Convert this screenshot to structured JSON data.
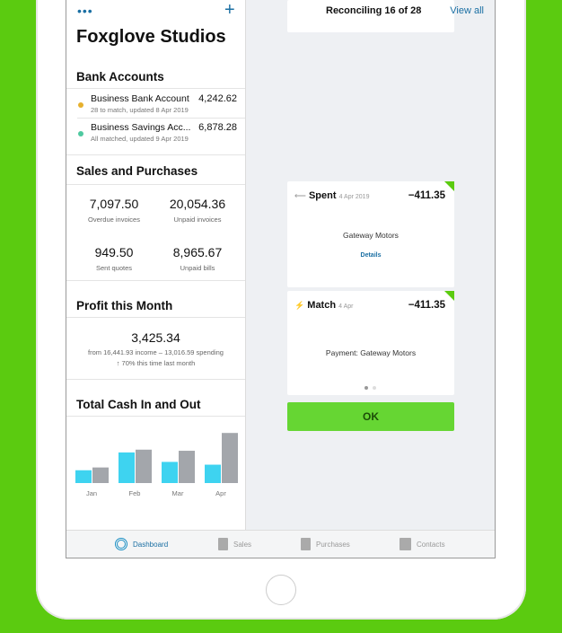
{
  "header": {
    "more": "•••",
    "add": "+",
    "org": "Foxglove Studios"
  },
  "bank": {
    "title": "Bank Accounts",
    "accounts": [
      {
        "name": "Business Bank Account",
        "amount": "4,242.62",
        "sub": "28 to match, updated 8 Apr 2019",
        "color": "#e6b02e"
      },
      {
        "name": "Business Savings Acc...",
        "amount": "6,878.28",
        "sub": "All matched, updated 9 Apr 2019",
        "color": "#4fc9a0"
      }
    ]
  },
  "sales": {
    "title": "Sales and Purchases",
    "stats": [
      {
        "value": "7,097.50",
        "label": "Overdue invoices"
      },
      {
        "value": "20,054.36",
        "label": "Unpaid invoices"
      },
      {
        "value": "949.50",
        "label": "Sent quotes"
      },
      {
        "value": "8,965.67",
        "label": "Unpaid bills"
      }
    ]
  },
  "profit": {
    "title": "Profit this Month",
    "value": "3,425.34",
    "detail": "from 16,441.93 income – 13,016.59 spending",
    "trend": "↑ 70% this time last month"
  },
  "chart_data": {
    "type": "bar",
    "title": "Total Cash In and Out",
    "categories": [
      "Jan",
      "Feb",
      "Mar",
      "Apr"
    ],
    "series": [
      {
        "values": [
          23,
          55,
          38,
          33
        ],
        "color": "#3ed3f0"
      },
      {
        "values": [
          28,
          60,
          58,
          90
        ],
        "color": "#a3a6ab"
      }
    ]
  },
  "reconcile": {
    "title": "Reconciling 16 of 28",
    "view_all": "View all",
    "spent": {
      "label": "Spent",
      "date": "4 Apr 2019",
      "amount": "−411.35",
      "payee": "Gateway Motors",
      "details": "Details"
    },
    "match": {
      "label": "Match",
      "date": "4 Apr",
      "amount": "−411.35",
      "payee": "Payment: Gateway Motors"
    },
    "ok": "OK"
  },
  "tabs": [
    {
      "label": "Dashboard",
      "active": true
    },
    {
      "label": "Sales"
    },
    {
      "label": "Purchases"
    },
    {
      "label": "Contacts"
    }
  ]
}
